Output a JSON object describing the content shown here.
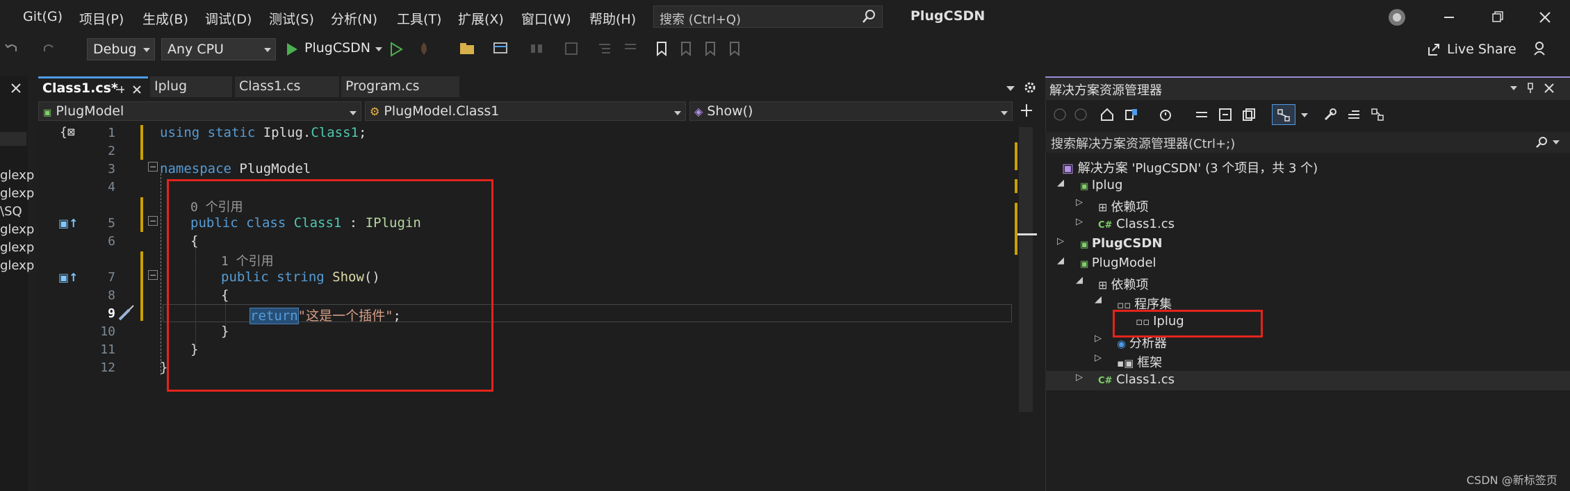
{
  "menu": [
    "Git(G)",
    "项目(P)",
    "生成(B)",
    "调试(D)",
    "测试(S)",
    "分析(N)",
    "工具(T)",
    "扩展(X)",
    "窗口(W)",
    "帮助(H)"
  ],
  "search": {
    "placeholder": "搜索 (Ctrl+Q)"
  },
  "solution_name": "PlugCSDN",
  "toolbar": {
    "config": "Debug",
    "platform": "Any CPU",
    "run_target": "PlugCSDN",
    "live_share": "Live Share"
  },
  "tabs": [
    {
      "label": "Class1.cs*",
      "active": true
    },
    {
      "label": "Iplug",
      "active": false
    },
    {
      "label": "Class1.cs",
      "active": false
    },
    {
      "label": "Program.cs",
      "active": false
    }
  ],
  "nav": {
    "project": "PlugModel",
    "class": "PlugModel.Class1",
    "member": "Show()"
  },
  "left_panel_fragments": [
    "glexp",
    "glexp",
    "\\SQ",
    "glexp",
    "glexp",
    "glexp"
  ],
  "code": {
    "line_numbers": [
      "1",
      "2",
      "3",
      "4",
      "5",
      "6",
      "7",
      "8",
      "9",
      "10",
      "11",
      "12"
    ],
    "l1_kw": "using static ",
    "l1_rest": "Iplug.",
    "l1_ty": "Class1",
    "l1_end": ";",
    "l3_kw": "namespace ",
    "l3_rest": "PlugModel",
    "ref0": "0 个引用",
    "l5_kw": "public class ",
    "l5_ty": "Class1",
    "l5_mid": " : ",
    "l5_if": "IPlugin",
    "brace_open": "{",
    "brace_close": "}",
    "ref1": "1 个引用",
    "l7_kw": "public string ",
    "l7_fn": "Show",
    "l7_end": "()",
    "l9_kw": "return",
    "l9_str": "\"这是一个插件\"",
    "l9_end": ";"
  },
  "solution_explorer": {
    "title": "解决方案资源管理器",
    "search_placeholder": "搜索解决方案资源管理器(Ctrl+;)",
    "items": [
      {
        "label": "解决方案 'PlugCSDN' (3 个项目，共 3 个)"
      },
      {
        "label": "Iplug"
      },
      {
        "label": "依赖项"
      },
      {
        "label": "Class1.cs"
      },
      {
        "label": "PlugCSDN"
      },
      {
        "label": "PlugModel"
      },
      {
        "label": "依赖项"
      },
      {
        "label": "程序集"
      },
      {
        "label": "Iplug"
      },
      {
        "label": "分析器"
      },
      {
        "label": "框架"
      },
      {
        "label": "Class1.cs"
      }
    ]
  },
  "badges": {
    "cs": "C#"
  },
  "watermark": "CSDN @新标签页",
  "colors": {
    "accent": "#4c9be8",
    "highlight_box": "#e3241c",
    "run_green": "#4caf50"
  }
}
